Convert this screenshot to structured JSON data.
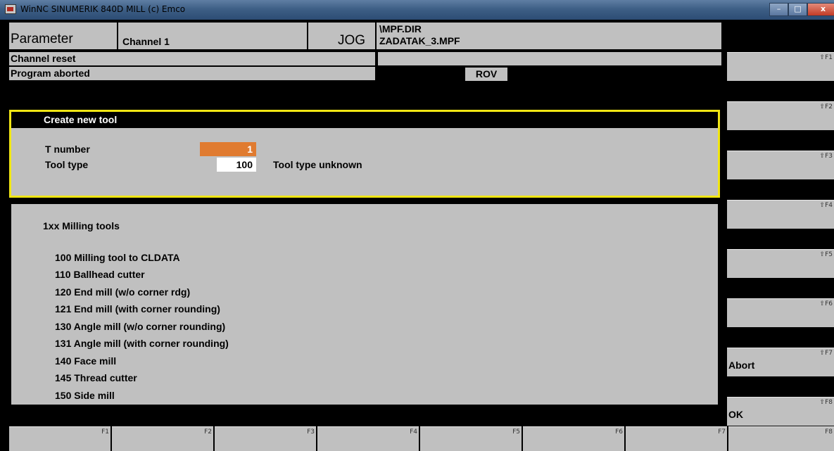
{
  "window": {
    "title": "WinNC SINUMERIK 840D MILL (c) Emco",
    "minimize": "–",
    "maximize": "□",
    "close": "x"
  },
  "header": {
    "area": "Parameter",
    "channel": "Channel 1",
    "mode": "JOG",
    "program_dir": "\\MPF.DIR",
    "program_name": "ZADATAK_3.MPF"
  },
  "status": {
    "channel_state": "Channel reset",
    "program_state": "Program aborted",
    "rov": "ROV"
  },
  "dialog": {
    "title": "Create new tool",
    "t_number_label": "T number",
    "t_number_value": "1",
    "tool_type_label": "Tool type",
    "tool_type_value": "100",
    "tool_type_desc": "Tool type unknown"
  },
  "tool_list": {
    "heading": "1xx Milling tools",
    "items": [
      "100 Milling tool to CLDATA",
      "110 Ballhead cutter",
      "120 End mill (w/o corner rdg)",
      "121 End mill (with corner rounding)",
      "130 Angle mill (w/o corner rounding)",
      "131 Angle mill (with corner rounding)",
      "140 Face mill",
      "145 Thread cutter",
      "150 Side mill"
    ]
  },
  "softkeys_right": [
    {
      "key": "⇧F1",
      "label": ""
    },
    {
      "key": "⇧F2",
      "label": ""
    },
    {
      "key": "⇧F3",
      "label": ""
    },
    {
      "key": "⇧F4",
      "label": ""
    },
    {
      "key": "⇧F5",
      "label": ""
    },
    {
      "key": "⇧F6",
      "label": ""
    },
    {
      "key": "⇧F7",
      "label": "Abort"
    },
    {
      "key": "⇧F8",
      "label": "OK"
    }
  ],
  "softkeys_bottom": [
    {
      "key": "F1"
    },
    {
      "key": "F2"
    },
    {
      "key": "F3"
    },
    {
      "key": "F4"
    },
    {
      "key": "F5"
    },
    {
      "key": "F6"
    },
    {
      "key": "F7"
    },
    {
      "key": "F8"
    }
  ],
  "colors": {
    "panel": "#c0c0c0",
    "highlight": "#e07b30",
    "dialog_border": "#f0e614",
    "background": "#000000"
  }
}
